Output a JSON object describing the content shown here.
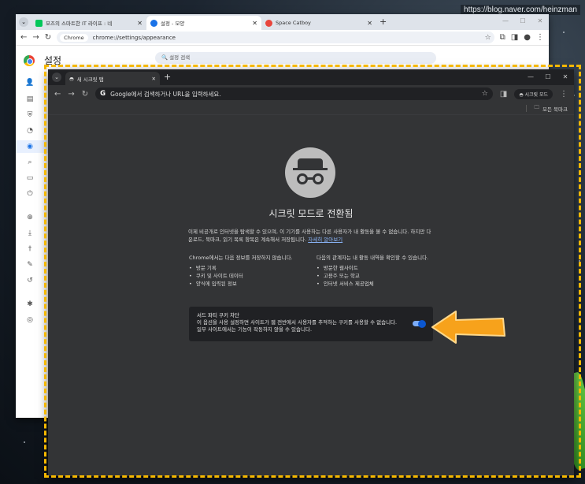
{
  "watermark": "https://blog.naver.com/heinzman",
  "settings_window": {
    "tabs": [
      {
        "label": "모즈의 스마트한 IT 라이프 : 네",
        "icon_color": "#03c75a"
      },
      {
        "label": "설정 - 모양",
        "icon_color": "#1a73e8"
      },
      {
        "label": "Space Catboy",
        "icon_color": "#e8453c"
      }
    ],
    "new_tab": "+",
    "chip": "Chrome",
    "url": "chrome://settings/appearance",
    "page_title": "설정",
    "search_placeholder": "설정 검색"
  },
  "incognito_window": {
    "tab_label": "새 시크릿 탭",
    "new_tab": "+",
    "omnibox": "Google에서 검색하거나 URL을 입력하세요.",
    "incognito_pill": "시크릿 모드",
    "bookmarks": "모든 북마크",
    "heading": "시크릿 모드로 전환됨",
    "description": "이제 비공개로 인터넷을 탐색할 수 있으며, 이 기기를 사용하는 다른 사용자가 내 활동을 볼 수 없습니다. 하지만 다운로드, 북마크, 읽기 목록 항목은 계속해서 저장됩니다.",
    "learn_more": "자세히 알아보기",
    "col1": {
      "title": "Chrome에서는 다음 정보를 저장하지 않습니다.",
      "items": [
        "방문 기록",
        "쿠키 및 사이트 데이터",
        "양식에 입력된 정보"
      ]
    },
    "col2": {
      "title": "다음의 관계자는 내 활동 내역을 확인할 수 있습니다.",
      "items": [
        "방문한 웹사이트",
        "고용주 또는 학교",
        "인터넷 서비스 제공업체"
      ]
    },
    "cookie": {
      "title": "서드 파티 쿠키 차단",
      "desc": "이 옵션을 사용 설정하면 사이트가 웹 전반에서 사용자를 추적하는 쿠키를 사용할 수 없습니다. 일부 사이트에서는 기능이 작동하지 않을 수 있습니다.",
      "enabled": true
    }
  },
  "colors": {
    "highlight": "#f5b800",
    "link": "#8ab4f8",
    "toggle": "#0b57d0"
  }
}
